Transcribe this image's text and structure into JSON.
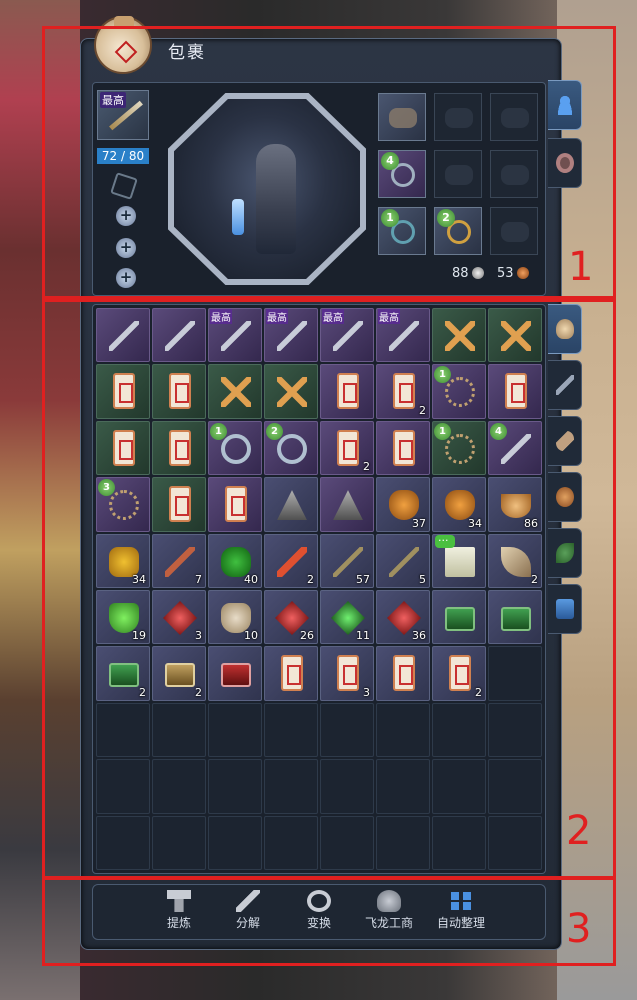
{
  "window": {
    "title": "包裹"
  },
  "equipment": {
    "weapon_tag": "最高",
    "durability": "72 / 80",
    "accessory_badges": [
      "4",
      "1",
      "2"
    ],
    "currency": {
      "silver": "88",
      "copper": "53"
    }
  },
  "side_tabs_top": [
    "character-tab",
    "wheel-tab"
  ],
  "side_tabs_inventory": [
    "all-items-tab",
    "weapons-tab",
    "horns-tab",
    "consumables-tab",
    "herbs-tab",
    "boxes-tab"
  ],
  "inventory": {
    "cells": [
      {
        "kind": "sword",
        "style": "purple"
      },
      {
        "kind": "sword",
        "style": "purple"
      },
      {
        "kind": "sword",
        "style": "purple",
        "tag": "最高"
      },
      {
        "kind": "sword",
        "style": "purple",
        "tag": "最高"
      },
      {
        "kind": "sword",
        "style": "purple",
        "tag": "最高"
      },
      {
        "kind": "sword",
        "style": "purple",
        "tag": "最高"
      },
      {
        "kind": "cross",
        "style": "green"
      },
      {
        "kind": "cross",
        "style": "green"
      },
      {
        "kind": "scroll",
        "style": "green"
      },
      {
        "kind": "scroll",
        "style": "green"
      },
      {
        "kind": "cross",
        "style": "green"
      },
      {
        "kind": "cross",
        "style": "green"
      },
      {
        "kind": "scroll",
        "style": "purple"
      },
      {
        "kind": "scroll",
        "style": "purple",
        "qty": "2"
      },
      {
        "kind": "neck",
        "style": "purple",
        "badge": "1"
      },
      {
        "kind": "scroll",
        "style": "purple"
      },
      {
        "kind": "scroll",
        "style": "green"
      },
      {
        "kind": "scroll",
        "style": "green"
      },
      {
        "kind": "ring",
        "style": "purple",
        "badge": "1"
      },
      {
        "kind": "ring",
        "style": "purple",
        "badge": "2"
      },
      {
        "kind": "scroll",
        "style": "purple",
        "qty": "2"
      },
      {
        "kind": "scroll",
        "style": "purple"
      },
      {
        "kind": "neck",
        "style": "green",
        "badge": "1"
      },
      {
        "kind": "sword",
        "style": "purple",
        "badge": "4"
      },
      {
        "kind": "neck",
        "style": "purple",
        "badge": "3"
      },
      {
        "kind": "scroll",
        "style": "green"
      },
      {
        "kind": "scroll",
        "style": "purple"
      },
      {
        "kind": "pyramid",
        "style": "item"
      },
      {
        "kind": "pyramid",
        "style": "purple"
      },
      {
        "kind": "potion",
        "style": "item",
        "qty": "37"
      },
      {
        "kind": "potion",
        "style": "item",
        "qty": "34"
      },
      {
        "kind": "bowl",
        "style": "item",
        "qty": "86"
      },
      {
        "kind": "ore",
        "style": "item",
        "qty": "34"
      },
      {
        "kind": "hammer",
        "style": "item",
        "qty": "7"
      },
      {
        "kind": "herb",
        "style": "item",
        "qty": "40"
      },
      {
        "kind": "stick",
        "style": "item",
        "qty": "2"
      },
      {
        "kind": "key",
        "style": "item",
        "qty": "57"
      },
      {
        "kind": "key",
        "style": "item",
        "qty": "5"
      },
      {
        "kind": "cloth",
        "style": "item",
        "chat": true
      },
      {
        "kind": "horn",
        "style": "item",
        "qty": "2"
      },
      {
        "kind": "flask",
        "style": "item",
        "qty": "19"
      },
      {
        "kind": "gem",
        "style": "item",
        "qty": "3"
      },
      {
        "kind": "bag",
        "style": "item",
        "qty": "10"
      },
      {
        "kind": "gem",
        "style": "item",
        "qty": "26"
      },
      {
        "kind": "green-gem",
        "style": "item",
        "qty": "11"
      },
      {
        "kind": "gem",
        "style": "item",
        "qty": "36"
      },
      {
        "kind": "chest-green",
        "style": "item"
      },
      {
        "kind": "chest-green",
        "style": "item"
      },
      {
        "kind": "chest-green",
        "style": "item",
        "qty": "2"
      },
      {
        "kind": "chest-gold",
        "style": "item",
        "qty": "2"
      },
      {
        "kind": "chest-red",
        "style": "item"
      },
      {
        "kind": "scroll",
        "style": "item"
      },
      {
        "kind": "scroll",
        "style": "item",
        "qty": "3"
      },
      {
        "kind": "scroll",
        "style": "item"
      },
      {
        "kind": "scroll",
        "style": "item",
        "qty": "2"
      },
      {
        "kind": "empty"
      }
    ],
    "total_cells": 80
  },
  "toolbar": {
    "buttons": [
      {
        "id": "refine",
        "label": "提炼",
        "icon": "anvil-icon"
      },
      {
        "id": "dismantle",
        "label": "分解",
        "icon": "hammer-icon"
      },
      {
        "id": "transform",
        "label": "变换",
        "icon": "cycle-icon"
      },
      {
        "id": "merchant",
        "label": "飞龙工商",
        "icon": "dragon-icon"
      },
      {
        "id": "autosort",
        "label": "自动整理",
        "icon": "grid-icon"
      }
    ]
  },
  "annotations": [
    {
      "label": "1"
    },
    {
      "label": "2"
    },
    {
      "label": "3"
    }
  ]
}
